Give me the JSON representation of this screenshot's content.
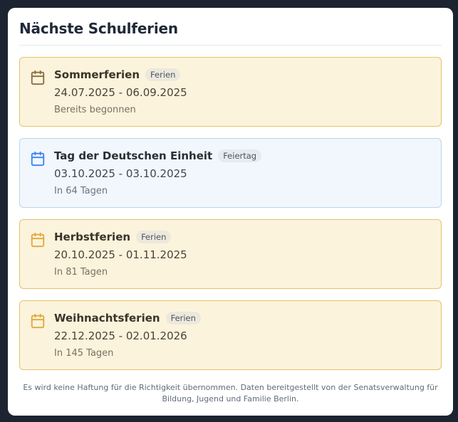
{
  "title": "Nächste Schulferien",
  "items": [
    {
      "name": "Sommerferien",
      "badge": "Ferien",
      "dates": "24.07.2025 - 06.09.2025",
      "status": "Bereits begonnen",
      "icon": "calendar-icon",
      "icon_color": "#8a6d3b"
    },
    {
      "name": "Tag der Deutschen Einheit",
      "badge": "Feiertag",
      "dates": "03.10.2025 - 03.10.2025",
      "status": "In 64 Tagen",
      "icon": "calendar-icon",
      "icon_color": "#3b82f6"
    },
    {
      "name": "Herbstferien",
      "badge": "Ferien",
      "dates": "20.10.2025 - 01.11.2025",
      "status": "In 81 Tagen",
      "icon": "calendar-icon",
      "icon_color": "#e0a93a"
    },
    {
      "name": "Weihnachtsferien",
      "badge": "Ferien",
      "dates": "22.12.2025 - 02.01.2026",
      "status": "In 145 Tagen",
      "icon": "calendar-icon",
      "icon_color": "#e0a93a"
    }
  ],
  "footer": "Es wird keine Haftung für die Richtigkeit übernommen. Daten bereitgestellt von der Senatsverwaltung für Bildung, Jugend und Familie Berlin.",
  "colors": {
    "ferien_bg": "#fbf3dc",
    "ferien_border": "#e6c36a",
    "feiertag_bg": "#f1f7fc",
    "feiertag_border": "#b9d7ee"
  }
}
